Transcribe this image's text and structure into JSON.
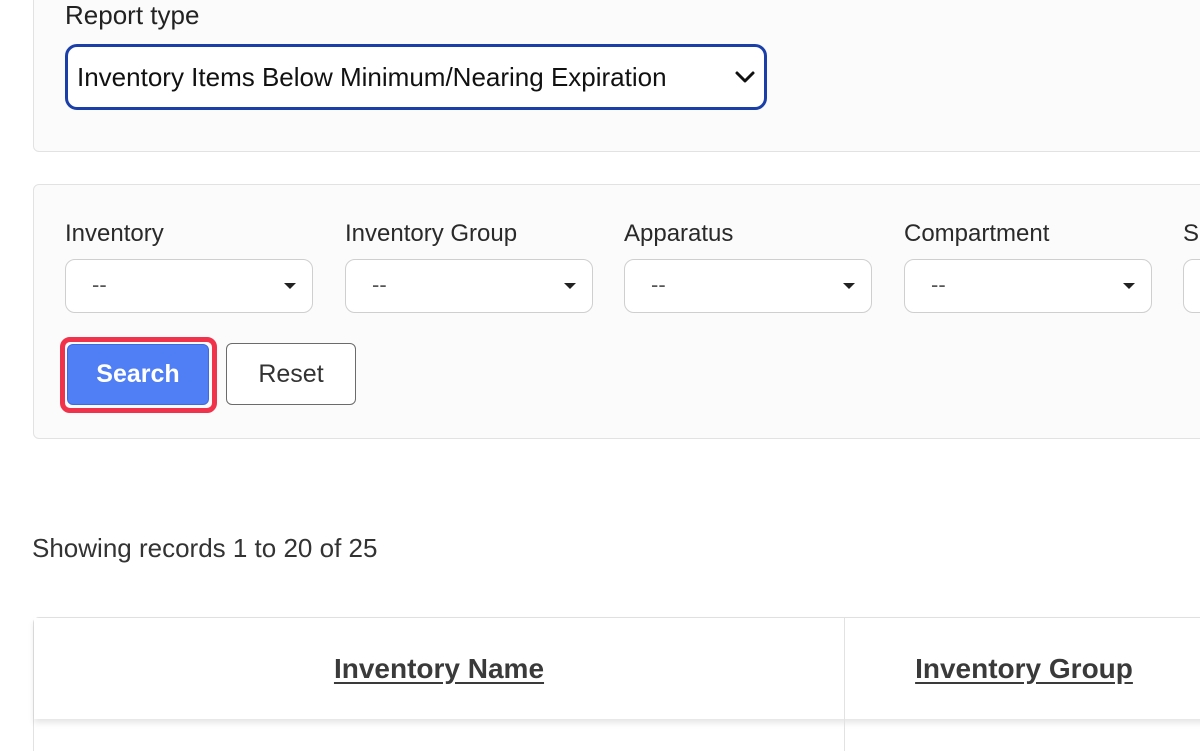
{
  "report": {
    "label": "Report type",
    "selected": "Inventory Items Below Minimum/Nearing Expiration"
  },
  "filters": [
    {
      "label": "Inventory",
      "value": "--"
    },
    {
      "label": "Inventory Group",
      "value": "--"
    },
    {
      "label": "Apparatus",
      "value": "--"
    },
    {
      "label": "Compartment",
      "value": "--"
    },
    {
      "label": "S",
      "value": ""
    }
  ],
  "actions": {
    "search_label": "Search",
    "reset_label": "Reset"
  },
  "records": {
    "summary": "Showing records 1 to 20 of 25"
  },
  "table": {
    "columns": [
      "Inventory Name",
      "Inventory Group"
    ]
  },
  "colors": {
    "primary": "#4f7ef5",
    "highlight": "#f0324a",
    "focus_border": "#1a3fa8"
  }
}
